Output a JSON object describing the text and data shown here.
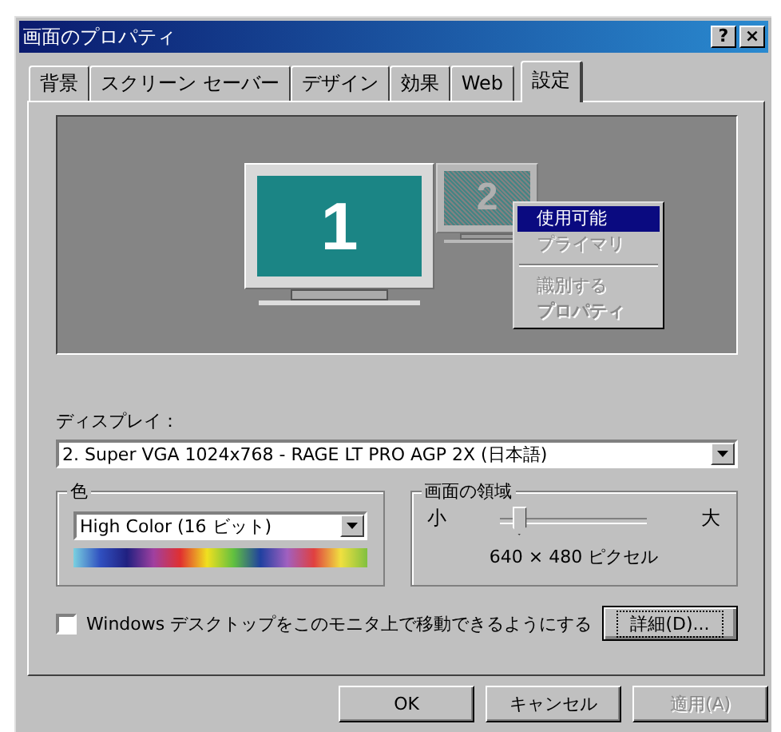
{
  "window": {
    "title": "画面のプロパティ",
    "title_buttons": [
      "?",
      "×"
    ]
  },
  "tabs": [
    {
      "label": "背景",
      "selected": false
    },
    {
      "label": "スクリーン セーバー",
      "selected": false
    },
    {
      "label": "デザイン",
      "selected": false
    },
    {
      "label": "効果",
      "selected": false
    },
    {
      "label": "Web",
      "selected": false
    },
    {
      "label": "設定",
      "selected": true
    }
  ],
  "monitors": [
    {
      "number": "1",
      "active": true
    },
    {
      "number": "2",
      "active": false
    }
  ],
  "context_menu": [
    {
      "kind": "item",
      "label": "使用可能",
      "selected": true,
      "disabled": false,
      "bold": false
    },
    {
      "kind": "item",
      "label": "プライマリ",
      "selected": false,
      "disabled": true,
      "bold": false
    },
    {
      "kind": "separator"
    },
    {
      "kind": "item",
      "label": "識別する",
      "selected": false,
      "disabled": true,
      "bold": false
    },
    {
      "kind": "item",
      "label": "プロパティ",
      "selected": false,
      "disabled": true,
      "bold": true
    }
  ],
  "display": {
    "label": "ディスプレイ：",
    "value": "2. Super VGA 1024x768 - RAGE LT PRO AGP 2X (日本語)"
  },
  "color": {
    "group": "色",
    "value": "High Color (16 ビット)"
  },
  "screen_area": {
    "group": "画面の領域",
    "min_label": "小",
    "max_label": "大",
    "level": 0.08,
    "reading": "640 × 480 ピクセル"
  },
  "extend_checkbox": {
    "label": "Windows デスクトップをこのモニタ上で移動できるようにする",
    "checked": false
  },
  "advanced_button": "詳細(D)...",
  "buttons": [
    {
      "label": "OK",
      "disabled": false
    },
    {
      "label": "キャンセル",
      "disabled": false
    },
    {
      "label": "適用(A)",
      "disabled": true
    }
  ]
}
